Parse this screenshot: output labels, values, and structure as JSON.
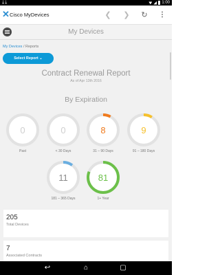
{
  "status_bar": {
    "left_icons": [
      "download-icon",
      "download-icon"
    ],
    "time": "1:00"
  },
  "browser": {
    "title": "Cisco MyDevices"
  },
  "header": {
    "title": "My Devices"
  },
  "breadcrumb": {
    "link": "My Devices",
    "separator": "/",
    "current": "Reports"
  },
  "select_report": {
    "label": "Select Report ⌄"
  },
  "report": {
    "title": "Contract Renewal Report",
    "subtitle": "As of Apr 13th 2016",
    "section": "By Expiration"
  },
  "gauges": [
    {
      "value": "0",
      "label": "Past",
      "fill": 0,
      "color": "#cfcfcf",
      "text_color": "#cfcfcf"
    },
    {
      "value": "0",
      "label": "< 30 Days",
      "fill": 0,
      "color": "#cfcfcf",
      "text_color": "#cfcfcf"
    },
    {
      "value": "8",
      "label": "31 – 90 Days",
      "fill": 0.08,
      "color": "#f07b1e",
      "text_color": "#f07b1e"
    },
    {
      "value": "9",
      "label": "91 – 180 Days",
      "fill": 0.09,
      "color": "#f6c02c",
      "text_color": "#f6c02c"
    },
    {
      "value": "11",
      "label": "181 – 365 Days",
      "fill": 0.1,
      "color": "#6aaee0",
      "text_color": "#8a8a8a"
    },
    {
      "value": "81",
      "label": "1+ Year",
      "fill": 0.81,
      "color": "#6cc04a",
      "text_color": "#6cc04a"
    }
  ],
  "cards": [
    {
      "value": "205",
      "label": "Total Devices"
    },
    {
      "value": "7",
      "label": "Associated Contracts"
    }
  ],
  "colors": {
    "accent": "#0d9ad7",
    "gauge_track": "#e2e2e2"
  }
}
